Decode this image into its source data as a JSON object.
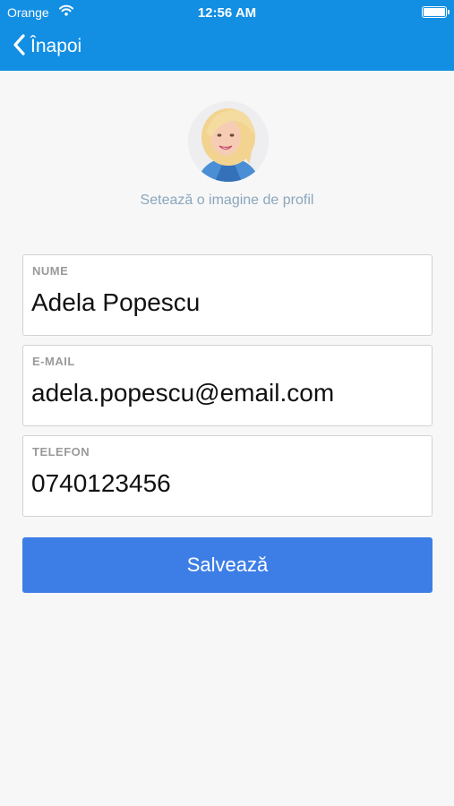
{
  "status_bar": {
    "carrier": "Orange",
    "time": "12:56 AM"
  },
  "nav": {
    "back_label": "Înapoi"
  },
  "profile": {
    "set_image_label": "Setează o imagine de profil"
  },
  "form": {
    "fields": [
      {
        "label": "NUME",
        "value": "Adela Popescu"
      },
      {
        "label": "E-MAIL",
        "value": "adela.popescu@email.com"
      },
      {
        "label": "TELEFON",
        "value": "0740123456"
      }
    ],
    "save_label": "Salvează"
  },
  "colors": {
    "header": "#128ee3",
    "button": "#3d7ee6",
    "link": "#8aa6bd"
  }
}
